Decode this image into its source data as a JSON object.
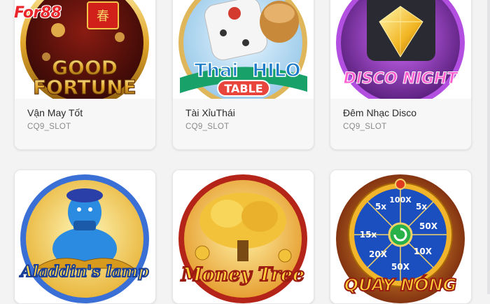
{
  "brand": {
    "logo_text": "For88"
  },
  "games": [
    {
      "title": "Vận May Tốt",
      "provider": "CQ9_SLOT",
      "art_text": "GOOD FORTUNE",
      "art_line1": "GOOD",
      "art_line2": "FORTUNE",
      "accent": "#c0281f"
    },
    {
      "title": "Tài XỉuThái",
      "provider": "CQ9_SLOT",
      "art_text": "Thai HILO TABLE",
      "art_line1": "Thai",
      "art_line1b": "HILO",
      "art_line2": "TABLE",
      "accent": "#1f8f5a"
    },
    {
      "title": "Đêm Nhạc Disco",
      "provider": "CQ9_SLOT",
      "art_text": "DISCO NIGHT",
      "art_line1": "DISCO NIGHT",
      "accent": "#9b2fc9"
    },
    {
      "art_text": "Aladdin's lamp",
      "accent": "#1b6fd1"
    },
    {
      "art_text": "Money Tree",
      "accent": "#c47a10"
    },
    {
      "art_text": "QUAY NÓNG",
      "wheel_labels": [
        "5x",
        "50X",
        "10X",
        "20X",
        "15x",
        "100X",
        "5x",
        "50X"
      ],
      "accent": "#d23a12"
    }
  ]
}
